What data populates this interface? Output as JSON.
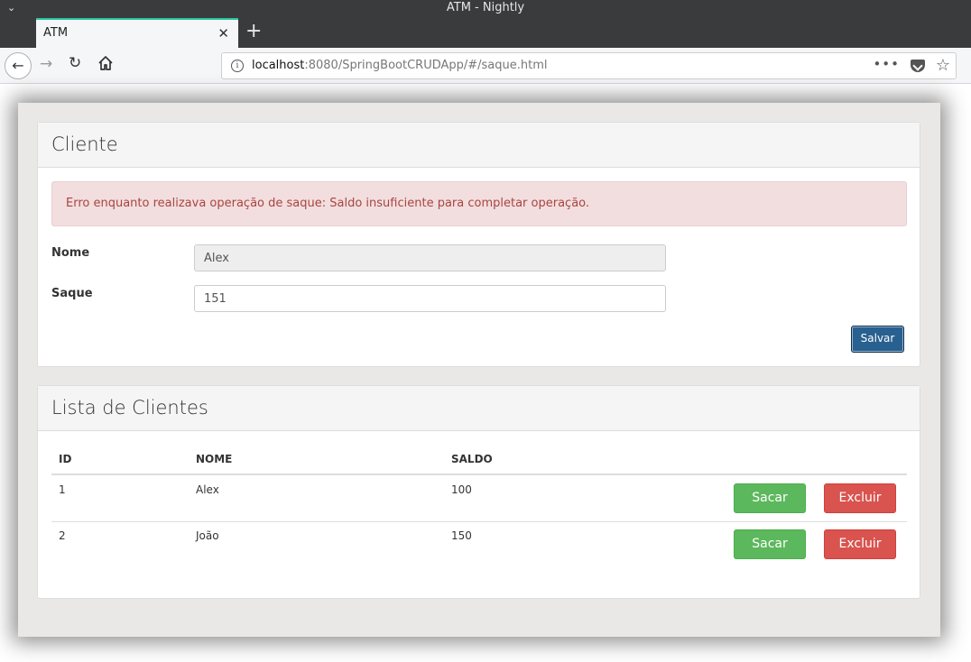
{
  "window": {
    "title": "ATM - Nightly"
  },
  "tabs": [
    {
      "title": "ATM"
    }
  ],
  "browser": {
    "url_host": "localhost",
    "url_rest": ":8080/SpringBootCRUDApp/#/saque.html",
    "page_actions": "•••",
    "icons": {
      "back": "arrow-left-icon",
      "forward": "arrow-right-icon",
      "reload": "reload-icon",
      "home": "home-icon",
      "star": "star-icon"
    }
  },
  "cliente_panel": {
    "title": "Cliente",
    "alert": "Erro enquanto realizava operação de saque: Saldo insuficiente para completar operação.",
    "nome_label": "Nome",
    "nome_value": "Alex",
    "saque_label": "Saque",
    "saque_value": "151",
    "save_label": "Salvar"
  },
  "lista_panel": {
    "title": "Lista de Clientes",
    "headers": [
      "ID",
      "NOME",
      "SALDO"
    ],
    "rows": [
      {
        "id": "1",
        "nome": "Alex",
        "saldo": "100"
      },
      {
        "id": "2",
        "nome": "João",
        "saldo": "150"
      }
    ],
    "sacar_label": "Sacar",
    "excluir_label": "Excluir"
  },
  "colors": {
    "primary": "#286090",
    "success": "#5cb85c",
    "danger": "#d9534f",
    "alert_bg": "#f2dede",
    "alert_text": "#a94442"
  }
}
